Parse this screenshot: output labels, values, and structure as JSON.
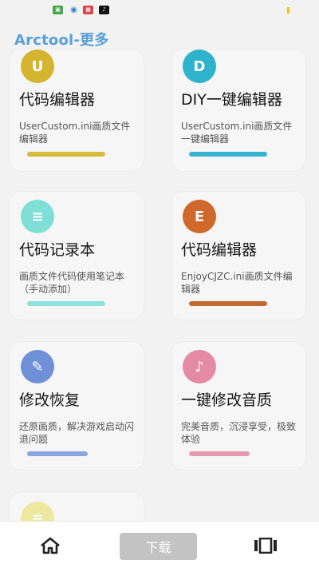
{
  "status_bar": {
    "icons": [
      "app-green-icon",
      "eye-icon",
      "app-red-icon",
      "tiktok-icon"
    ]
  },
  "header": {
    "title": "Arctool-更多"
  },
  "cards": [
    {
      "icon": "U",
      "icon_color": "#d4b52f",
      "title": "代码编辑器",
      "desc": "UserCustom.ini画质文件编辑器",
      "bar_color": "#d6bb3c"
    },
    {
      "icon": "D",
      "icon_color": "#2fb3cc",
      "title": "DIY一键编辑器",
      "desc": "UserCustom.ini画质文件一键编辑器",
      "bar_color": "#36b4cf"
    },
    {
      "icon": "≡",
      "icon_color": "#7fded6",
      "title": "代码记录本",
      "desc": "画质文件代码使用笔记本（手动添加）",
      "bar_color": "#8fe2dc"
    },
    {
      "icon": "E",
      "icon_color": "#d0672b",
      "title": "代码编辑器",
      "desc": "EnjoyCJZC.ini画质文件编辑器",
      "bar_color": "#c26a34"
    },
    {
      "icon": "✎",
      "icon_color": "#6f8fd6",
      "title": "修改恢复",
      "desc": "还原画质，解决游戏启动闪退问题",
      "bar_color": "#8aa5e0"
    },
    {
      "icon": "♪",
      "icon_color": "#e48aa4",
      "title": "一键修改音质",
      "desc": "完美音质，沉浸享受，极致体验",
      "bar_color": "#e69ab1"
    },
    {
      "icon": "≡",
      "icon_color": "#e9e47a",
      "title": "",
      "desc": "",
      "bar_color": ""
    }
  ],
  "bottom_nav": {
    "home_icon": "home-icon",
    "download_label": "下载",
    "menu_icon": "film-icon"
  }
}
